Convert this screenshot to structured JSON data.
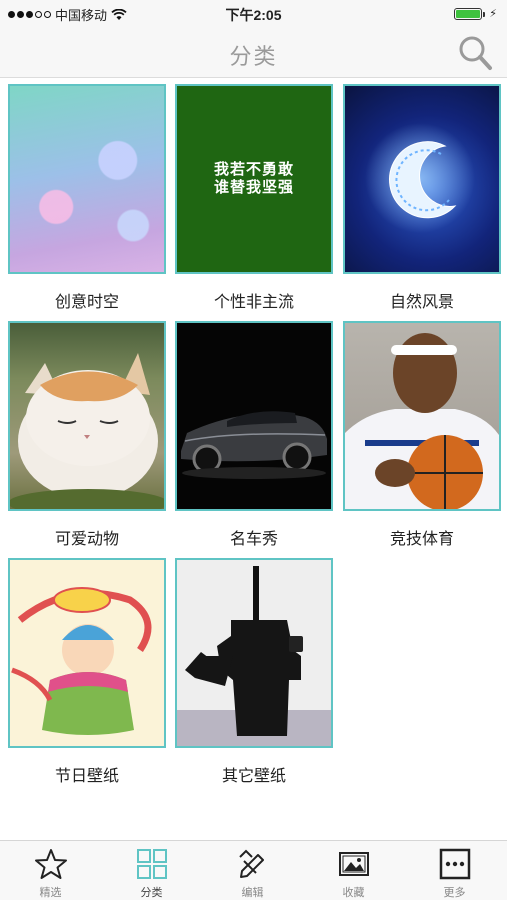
{
  "status_bar": {
    "carrier": "中国移动",
    "time": "下午2:05",
    "battery_percent": 100
  },
  "nav": {
    "title": "分类",
    "search_icon": "search-icon"
  },
  "categories": [
    {
      "label": "创意时空"
    },
    {
      "label": "个性非主流",
      "image_text_line1": "我若不勇敢",
      "image_text_line2": "谁替我坚强"
    },
    {
      "label": "自然风景"
    },
    {
      "label": "可爱动物"
    },
    {
      "label": "名车秀"
    },
    {
      "label": "竞技体育"
    },
    {
      "label": "节日壁纸"
    },
    {
      "label": "其它壁纸"
    }
  ],
  "tabs": [
    {
      "label": "精选",
      "icon": "star-icon"
    },
    {
      "label": "分类",
      "icon": "grid-icon",
      "active": true
    },
    {
      "label": "编辑",
      "icon": "edit-icon"
    },
    {
      "label": "收藏",
      "icon": "image-icon"
    },
    {
      "label": "更多",
      "icon": "more-icon"
    }
  ],
  "colors": {
    "accent": "#5fc4c4",
    "tab_active": "#5fc4c4",
    "tab_inactive": "#222222"
  }
}
